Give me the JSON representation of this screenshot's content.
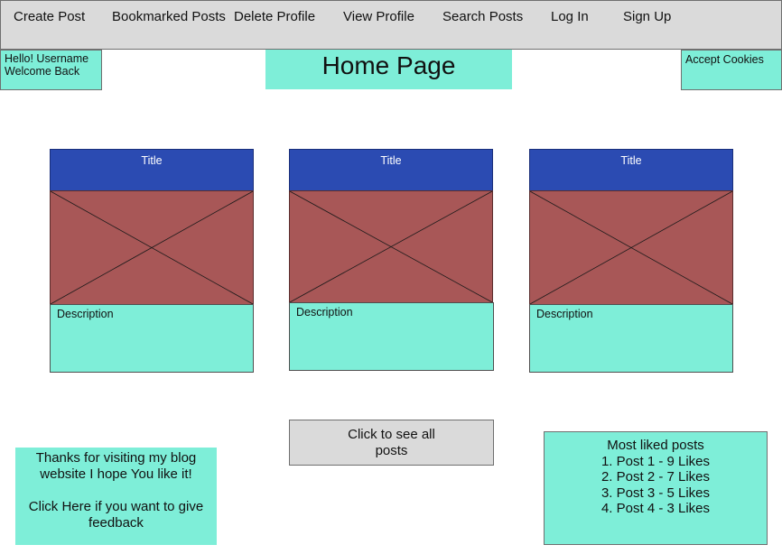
{
  "nav": {
    "items": [
      "Create Post",
      "Bookmarked Posts",
      "Delete Profile",
      "View Profile",
      "Search Posts",
      "Log In",
      "Sign Up"
    ]
  },
  "header": {
    "greeting_line1": "Hello! Username",
    "greeting_line2": "Welcome Back",
    "title": "Home Page",
    "cookies_label": "Accept Cookies"
  },
  "cards": [
    {
      "title": "Title",
      "description": "Description"
    },
    {
      "title": "Title",
      "description": "Description"
    },
    {
      "title": "Title",
      "description": "Description"
    }
  ],
  "see_all": {
    "line1": "Click to see all",
    "line2": "posts"
  },
  "thanks": {
    "line1": "Thanks for visiting my blog",
    "line2": "website I hope You like it!",
    "feedback_line1": "Click Here if you want to give",
    "feedback_line2": "feedback"
  },
  "most_liked": {
    "heading": "Most liked posts",
    "items": [
      "1. Post 1  - 9 Likes",
      "2. Post 2 - 7 Likes",
      "3. Post 3 - 5 Likes",
      "4. Post 4 - 3 Likes"
    ]
  },
  "colors": {
    "nav_bg": "#dadada",
    "teal": "#7eeed8",
    "card_title_blue": "#2b4bb2",
    "image_placeholder": "#a85757"
  }
}
